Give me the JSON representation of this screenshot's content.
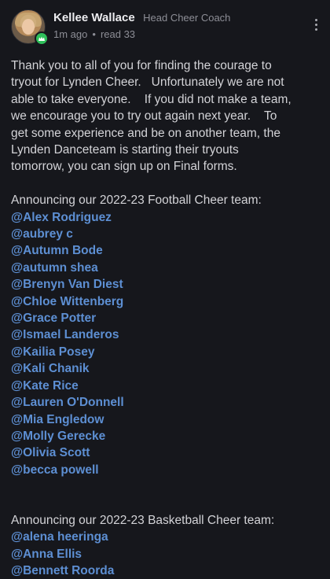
{
  "post": {
    "author_name": "Kellee Wallace",
    "author_role": "Head Cheer Coach",
    "time_ago": "1m ago",
    "separator": "•",
    "read_count": "read 33",
    "message_lines": [
      "Thank you to all of you for finding the courage to",
      "tryout for Lynden Cheer.   Unfortunately we are not",
      "able to take everyone.    If you did not make a team,",
      "we encourage you to try out again next year.    To",
      "get some experience and be on another team, the",
      "Lynden Danceteam is starting their tryouts",
      "tomorrow, you can sign up on Final forms."
    ],
    "football_heading": "Announcing our 2022-23 Football Cheer team:",
    "football_team": [
      "@Alex Rodriguez",
      "@aubrey c",
      "@Autumn Bode",
      "@autumn shea",
      "@Brenyn Van Diest",
      "@Chloe Wittenberg",
      "@Grace Potter",
      "@Ismael Landeros",
      "@Kailia Posey",
      "@Kali Chanik",
      "@Kate Rice",
      "@Lauren O'Donnell",
      "@Mia Engledow",
      "@Molly Gerecke",
      "@Olivia Scott",
      "@becca powell"
    ],
    "basketball_heading": "Announcing our 2022-23 Basketball Cheer team:",
    "basketball_team": [
      "@alena heeringa",
      "@Anna Ellis",
      "@Bennett Roorda"
    ]
  },
  "icons": {
    "avatar": "author-avatar",
    "badge": "crown-badge-icon",
    "menu": "more-vertical-icon"
  },
  "colors": {
    "background": "#16171c",
    "mention": "#5d8fd3",
    "badge": "#2fbf5a"
  }
}
